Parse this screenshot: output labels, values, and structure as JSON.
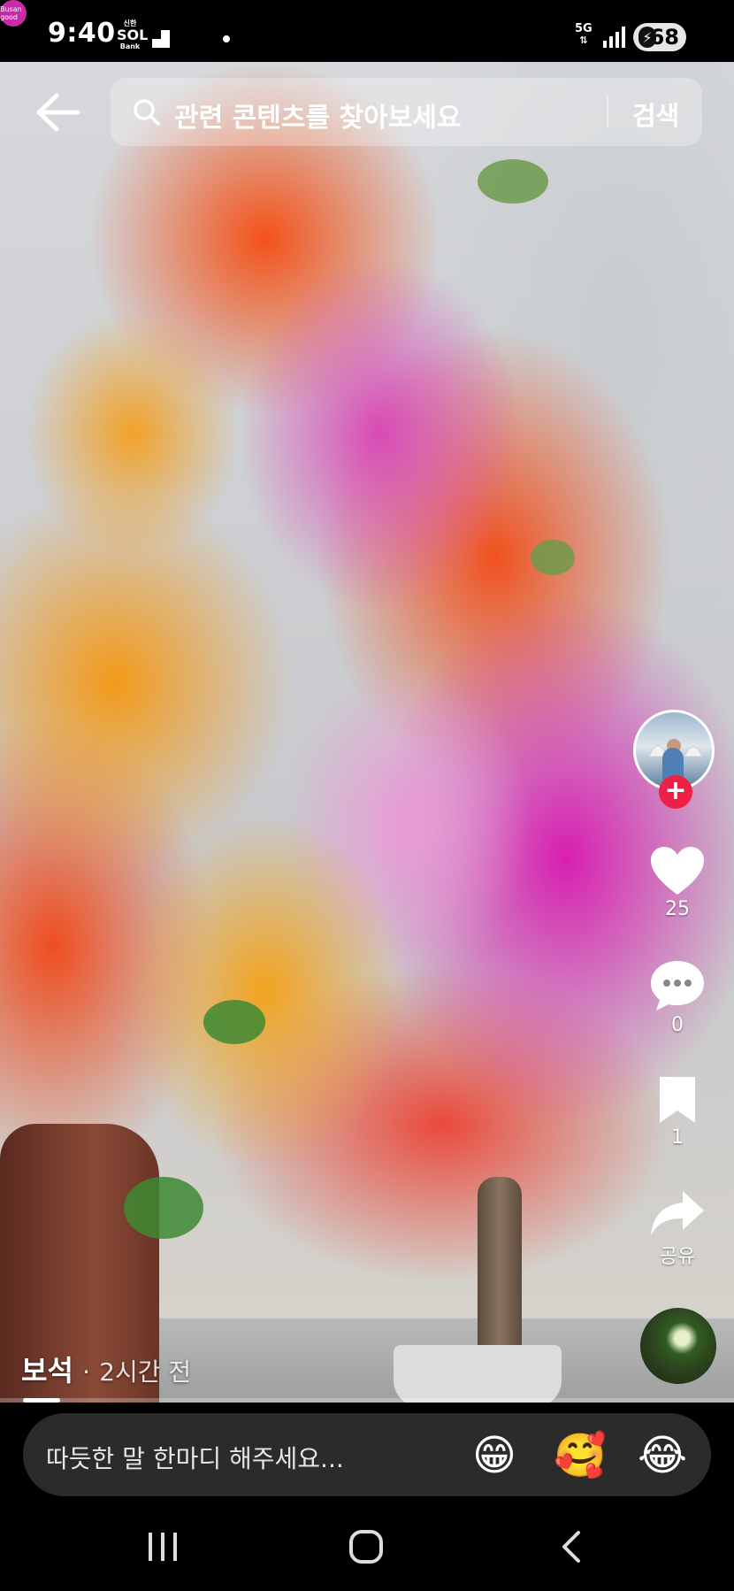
{
  "status_bar": {
    "time": "9:40",
    "sol_top": "신한",
    "sol_main": "SOL",
    "sol_bottom": "Bank",
    "busan_label": "Busan good",
    "network": "5G",
    "battery": "68"
  },
  "search": {
    "placeholder": "관련 콘텐츠를 찾아보세요",
    "button_label": "검색"
  },
  "rail": {
    "likes": "25",
    "comments": "0",
    "saves": "1",
    "share_label": "공유"
  },
  "caption": {
    "author": "보석",
    "separator": "·",
    "time_ago": "2시간 전"
  },
  "progress": 0.05,
  "comment": {
    "placeholder": "따듯한 말 한마디 해주세요...",
    "emojis": [
      "😁",
      "🥰",
      "😂"
    ]
  },
  "colors": {
    "follow_badge": "#ee2045",
    "comment_bg": "#2b2b2b"
  },
  "icons": [
    "back-arrow-icon",
    "search-icon",
    "heart-icon",
    "comment-icon",
    "bookmark-icon",
    "share-icon",
    "recents-icon",
    "home-icon",
    "back-icon"
  ]
}
